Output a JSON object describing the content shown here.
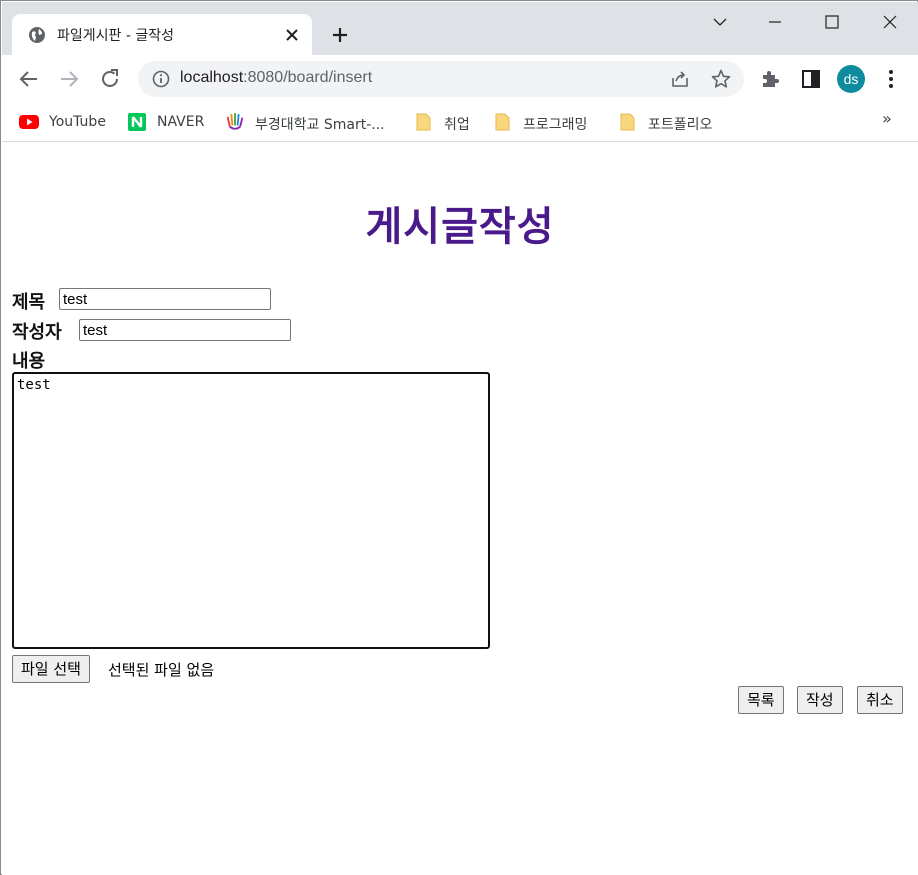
{
  "browser": {
    "tab_title": "파일게시판 - 글작성",
    "url_host": "localhost",
    "url_rest": ":8080/board/insert",
    "profile_initials": "ds",
    "profile_color": "#0f8b9e"
  },
  "bookmarks": [
    {
      "label": "YouTube",
      "icon": "youtube-icon"
    },
    {
      "label": "NAVER",
      "icon": "naver-icon"
    },
    {
      "label": "부경대학교 Smart-...",
      "icon": "pknu-icon"
    },
    {
      "label": "취업",
      "icon": "folder-icon"
    },
    {
      "label": "프로그래밍",
      "icon": "folder-icon"
    },
    {
      "label": "포트폴리오",
      "icon": "folder-icon"
    }
  ],
  "bookmarks_more": "»",
  "page": {
    "title": "게시글작성",
    "title_color": "#4b1a8a",
    "form": {
      "subject_label": "제목",
      "subject_value": "test",
      "writer_label": "작성자",
      "writer_value": "test",
      "content_label": "내용",
      "content_value": "test",
      "file_button": "파일 선택",
      "file_status": "선택된 파일 없음"
    },
    "actions": {
      "list": "목록",
      "write": "작성",
      "cancel": "취소"
    }
  }
}
